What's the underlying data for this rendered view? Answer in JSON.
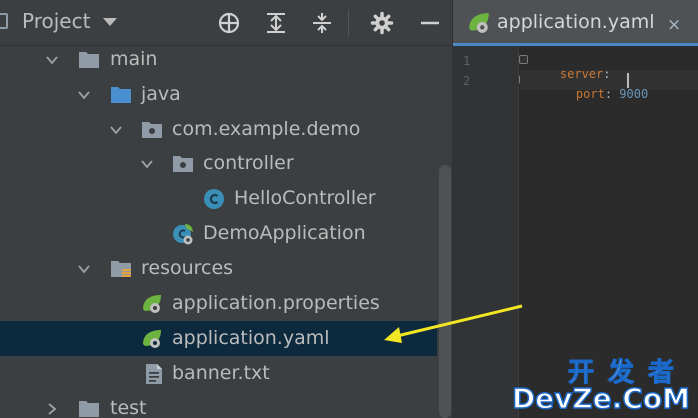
{
  "project_panel": {
    "title": "Project",
    "toolbar": [
      "locate-icon",
      "expand-all-icon",
      "collapse-all-icon",
      "gear-icon",
      "hide-icon"
    ],
    "tree": [
      {
        "label": "main",
        "kind": "folder",
        "expanded": true
      },
      {
        "label": "java",
        "kind": "source-folder",
        "expanded": true
      },
      {
        "label": "com.example.demo",
        "kind": "package",
        "expanded": true
      },
      {
        "label": "controller",
        "kind": "package",
        "expanded": true
      },
      {
        "label": "HelloController",
        "kind": "class"
      },
      {
        "label": "DemoApplication",
        "kind": "spring-boot-class"
      },
      {
        "label": "resources",
        "kind": "resources-folder",
        "expanded": true
      },
      {
        "label": "application.properties",
        "kind": "spring-config"
      },
      {
        "label": "application.yaml",
        "kind": "spring-config",
        "selected": true
      },
      {
        "label": "banner.txt",
        "kind": "text-file"
      },
      {
        "label": "test",
        "kind": "folder",
        "expanded": false
      }
    ]
  },
  "editor": {
    "tab": {
      "label": "application.yaml",
      "close": "×"
    },
    "lines": [
      {
        "number": "1",
        "key": "server",
        "colon": ":",
        "value": ""
      },
      {
        "number": "2",
        "key": "port",
        "colon": ": ",
        "value": "9000"
      }
    ]
  },
  "watermark": {
    "top": "开发者",
    "bottom": "DevZe.CoM"
  },
  "colors": {
    "selection": "#0d293e",
    "arrow": "#f2e722",
    "yaml_key": "#cc7832",
    "number": "#6897bb",
    "folder": "#8f9ba6",
    "source_folder": "#4a8fd0",
    "class_icon": "#3a8fb7"
  }
}
